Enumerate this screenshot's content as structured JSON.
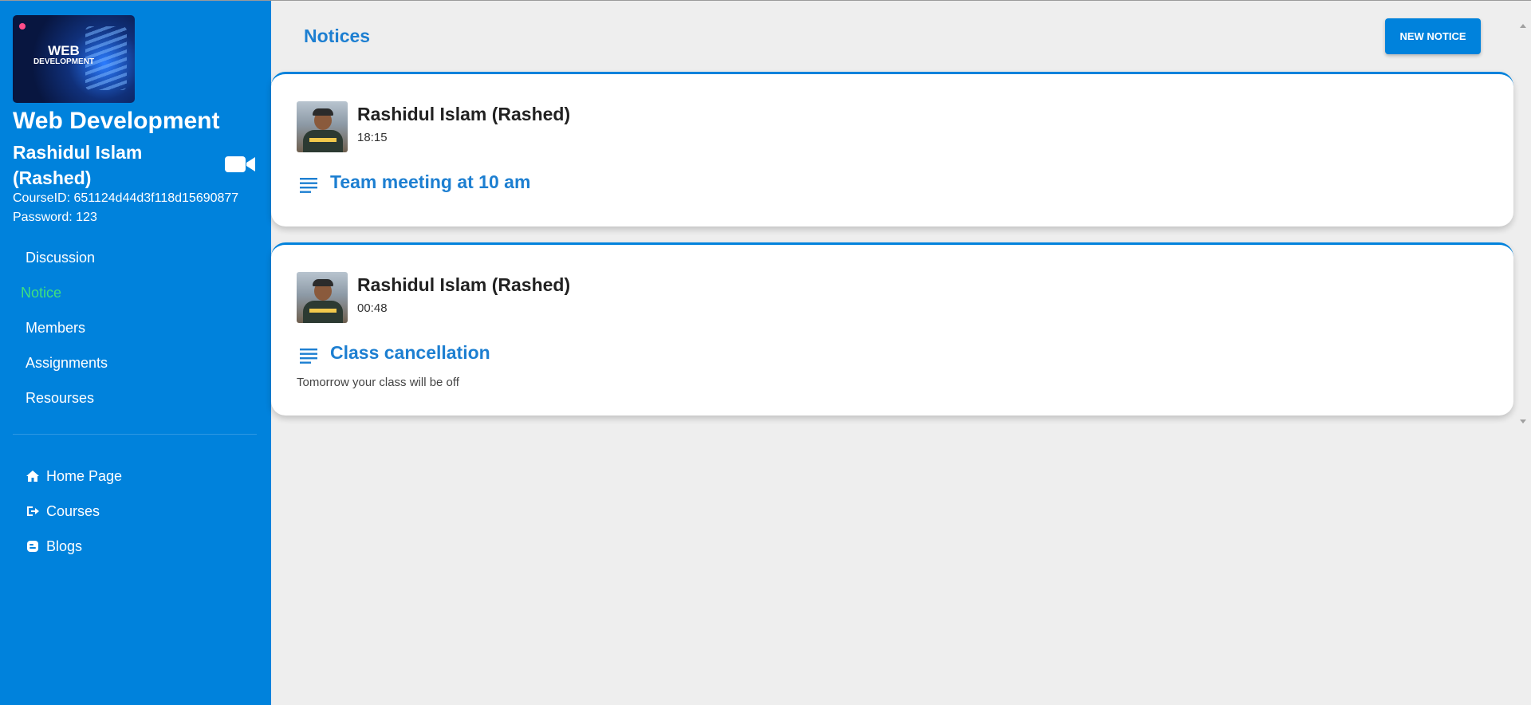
{
  "sidebar": {
    "logo": {
      "line1": "Web",
      "line2": "Development"
    },
    "course_title": "Web Development",
    "teacher_name": "Rashidul Islam (Rashed)",
    "course_id": "CourseID: 651124d44d3f118d15690877",
    "password": "Password: 123",
    "nav": [
      {
        "label": "Discussion",
        "active": false
      },
      {
        "label": "Notice",
        "active": true
      },
      {
        "label": "Members",
        "active": false
      },
      {
        "label": "Assignments",
        "active": false
      },
      {
        "label": "Resourses",
        "active": false
      }
    ],
    "links": [
      {
        "label": "Home Page",
        "icon": "home-icon"
      },
      {
        "label": "Courses",
        "icon": "sign-out-icon"
      },
      {
        "label": "Blogs",
        "icon": "blogger-icon"
      }
    ],
    "accent_color": "#0082dc",
    "active_color": "#3ee07f"
  },
  "main": {
    "title": "Notices",
    "new_notice_label": "NEW NOTICE",
    "notices": [
      {
        "author": "Rashidul Islam (Rashed)",
        "time": "18:15",
        "title": "Team meeting at 10 am",
        "body": ""
      },
      {
        "author": "Rashidul Islam (Rashed)",
        "time": "00:48",
        "title": "Class cancellation",
        "body": "Tomorrow your class will be off"
      }
    ]
  }
}
